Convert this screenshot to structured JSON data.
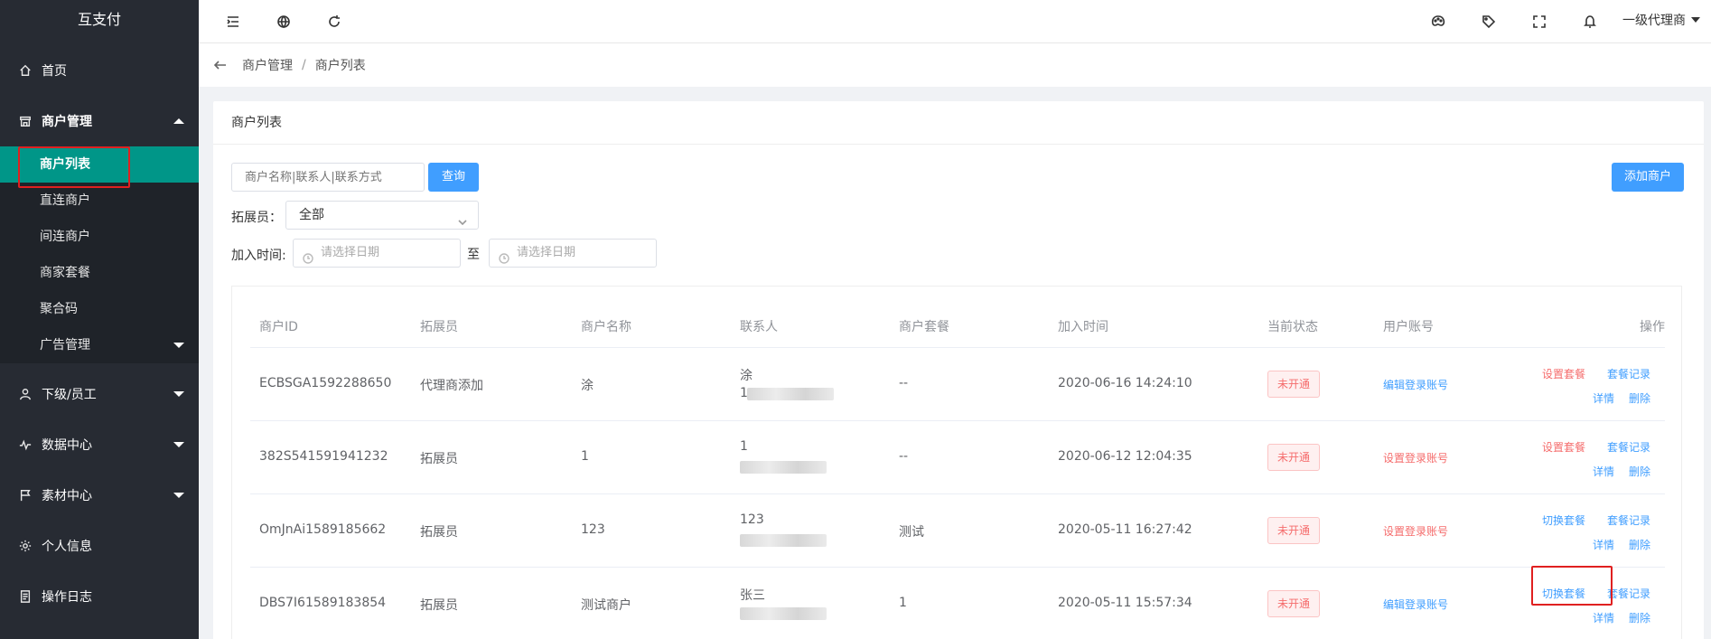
{
  "sidebar": {
    "brand": "互支付",
    "items": [
      {
        "label": "首页",
        "icon": "home-icon"
      },
      {
        "label": "商户管理",
        "icon": "shop-icon"
      },
      {
        "label": "下级/员工",
        "icon": "user-icon"
      },
      {
        "label": "数据中心",
        "icon": "chart-pulse-icon"
      },
      {
        "label": "素材中心",
        "icon": "flag-icon"
      },
      {
        "label": "个人信息",
        "icon": "gear-icon"
      },
      {
        "label": "操作日志",
        "icon": "document-icon"
      }
    ],
    "submenu": [
      {
        "label": "商户列表"
      },
      {
        "label": "直连商户"
      },
      {
        "label": "间连商户"
      },
      {
        "label": "商家套餐"
      },
      {
        "label": "聚合码"
      },
      {
        "label": "广告管理"
      }
    ]
  },
  "header": {
    "user_label": "一级代理商",
    "icons": [
      "menu-fold-icon",
      "globe-icon",
      "refresh-icon",
      "palette-icon",
      "tag-icon",
      "fullscreen-icon",
      "bell-icon"
    ]
  },
  "breadcrumb": {
    "first": "商户管理",
    "separator": "/",
    "second": "商户列表"
  },
  "card": {
    "title": "商户列表",
    "search_placeholder": "商户名称|联系人|联系方式",
    "search_button": "查询",
    "add_button": "添加商户",
    "expander_label": "拓展员：",
    "expander_value": "全部",
    "join_time_label": "加入时间:",
    "date_placeholder_start": "请选择日期",
    "date_to": "至",
    "date_placeholder_end": "请选择日期"
  },
  "table": {
    "headers": [
      "商户ID",
      "拓展员",
      "商户名称",
      "联系人",
      "商户套餐",
      "加入时间",
      "当前状态",
      "用户账号",
      "操作"
    ],
    "rows": [
      {
        "id": "ECBSGA1592288650",
        "expander": "代理商添加",
        "name": "涂",
        "contact": "涂",
        "contact2": "1",
        "package": "--",
        "joined": "2020-06-16 14:24:10",
        "status": "未开通",
        "account": "编辑登录账号",
        "account_color": "blue",
        "op1": "设置套餐",
        "op1_color": "red",
        "op2": "套餐记录",
        "op3": "详情",
        "op4": "删除"
      },
      {
        "id": "382S541591941232",
        "expander": "拓展员",
        "name": "1",
        "contact": "1",
        "contact2": "",
        "package": "--",
        "joined": "2020-06-12 12:04:35",
        "status": "未开通",
        "account": "设置登录账号",
        "account_color": "red",
        "op1": "设置套餐",
        "op1_color": "red",
        "op2": "套餐记录",
        "op3": "详情",
        "op4": "删除"
      },
      {
        "id": "OmJnAi1589185662",
        "expander": "拓展员",
        "name": "123",
        "contact": "123",
        "contact2": "",
        "package": "测试",
        "joined": "2020-05-11 16:27:42",
        "status": "未开通",
        "account": "设置登录账号",
        "account_color": "red",
        "op1": "切换套餐",
        "op1_color": "blue",
        "op2": "套餐记录",
        "op3": "详情",
        "op4": "删除"
      },
      {
        "id": "DBS7I61589183854",
        "expander": "拓展员",
        "name": "测试商户",
        "contact": "张三",
        "contact2": "",
        "package": "1",
        "joined": "2020-05-11 15:57:34",
        "status": "未开通",
        "account": "编辑登录账号",
        "account_color": "blue",
        "op1": "切换套餐",
        "op1_color": "blue",
        "op2": "套餐记录",
        "op3": "详情",
        "op4": "删除"
      }
    ]
  },
  "colors": {
    "sidebar_bg": "#272b33",
    "active_menu": "#009688",
    "primary": "#409eff",
    "danger": "#f56c6c",
    "highlight": "#e02020"
  }
}
